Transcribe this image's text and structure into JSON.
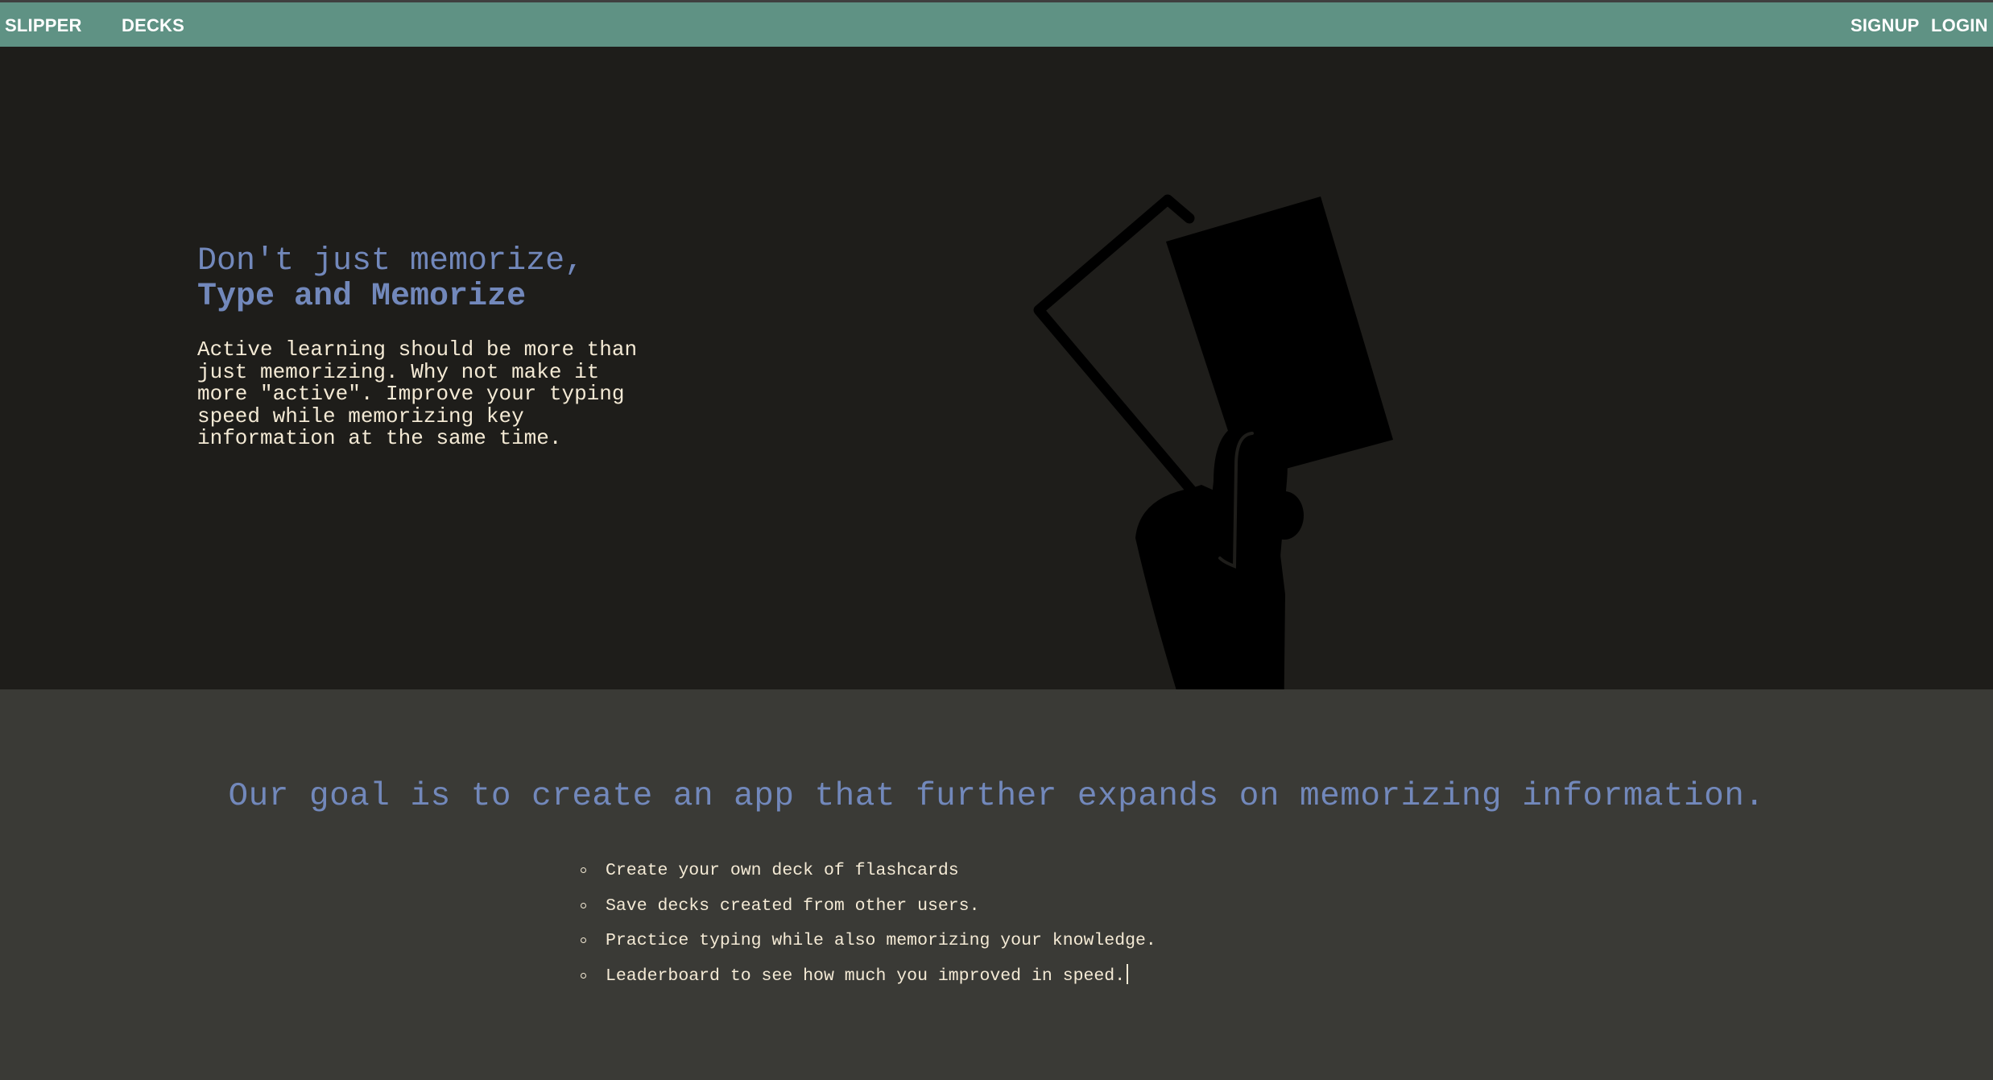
{
  "nav": {
    "brand": "SLIPPER",
    "decks": "DECKS",
    "signup": "SIGNUP",
    "login": "LOGIN"
  },
  "hero": {
    "headline_line1": "Don't just memorize,",
    "headline_line2": "Type and Memorize",
    "description": "Active learning should be more than just memorizing. Why not make it more \"active\". Improve your typing speed while memorizing key information at the same time.",
    "illustration_icon": "hand-holding-cards-icon"
  },
  "goals": {
    "heading": "Our goal is to create an app that further expands on memorizing information.",
    "features": [
      "Create your own deck of flashcards",
      "Save decks created from other users.",
      "Practice typing while also memorizing your knowledge.",
      "Leaderboard to see how much you improved in speed."
    ]
  },
  "colors": {
    "nav_background": "#5f9284",
    "hero_background": "#1e1d1a",
    "section_background": "#3a3a36",
    "accent_blue": "#7288bb",
    "body_text": "#f4ead5"
  }
}
